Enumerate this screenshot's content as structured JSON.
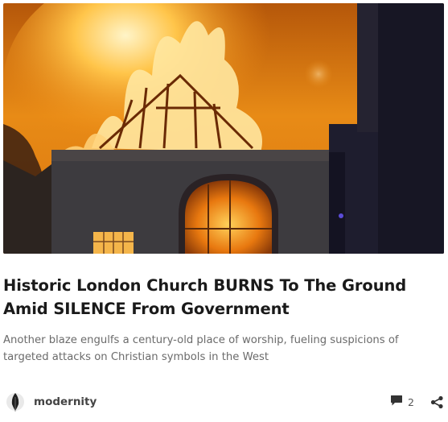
{
  "post": {
    "title": "Historic London Church BURNS To The Ground Amid SILENCE From Government",
    "subtitle": "Another blaze engulfs a century-old place of worship, fueling suspicions of targeted attacks on Christian symbols in the West",
    "author": "modernity",
    "comment_count": "2"
  },
  "icons": {
    "avatar": "black-feather-icon",
    "comment": "speech-bubble-icon",
    "share": "share-icon"
  },
  "colors": {
    "title": "#1a1a1a",
    "subtitle": "#6b6b6b",
    "fire": "#f7a21b",
    "sky": "#e98b10"
  }
}
